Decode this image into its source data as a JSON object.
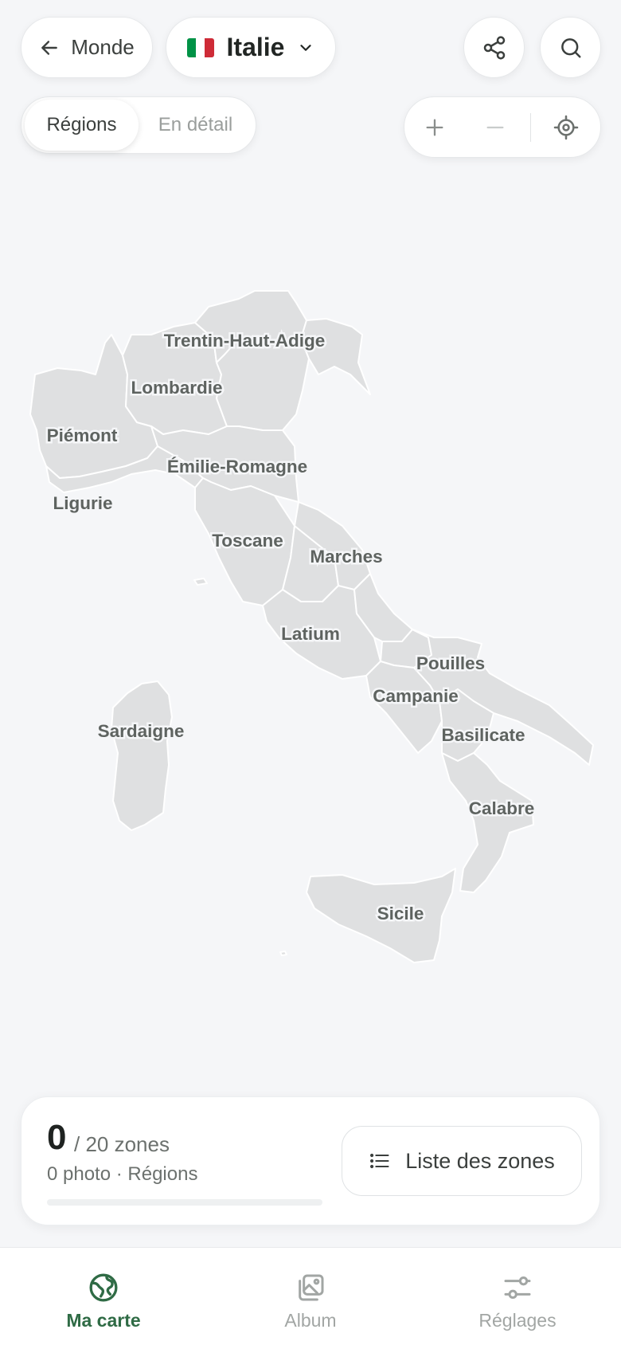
{
  "header": {
    "back_label": "Monde",
    "country": "Italie",
    "flag_colors": [
      "#009246",
      "#ffffff",
      "#ce2b37"
    ]
  },
  "mode_toggle": {
    "active": "Régions",
    "inactive": "En détail"
  },
  "map": {
    "fill_color": "#dfe0e1",
    "regions": [
      "Trentin-Haut-Adige",
      "Lombardie",
      "Piémont",
      "Émilie-Romagne",
      "Ligurie",
      "Toscane",
      "Marches",
      "Latium",
      "Pouilles",
      "Campanie",
      "Basilicate",
      "Sardaigne",
      "Calabre",
      "Sicile"
    ]
  },
  "stats": {
    "visited": "0",
    "total": "/ 20 zones",
    "photo_line": "0 photo · Régions",
    "progress": 0,
    "list_button": "Liste des zones"
  },
  "nav": {
    "items": [
      {
        "label": "Ma carte",
        "icon": "globe-icon",
        "active": true
      },
      {
        "label": "Album",
        "icon": "photo-album-icon",
        "active": false
      },
      {
        "label": "Réglages",
        "icon": "sliders-icon",
        "active": false
      }
    ],
    "accent": "#2f6b45"
  }
}
